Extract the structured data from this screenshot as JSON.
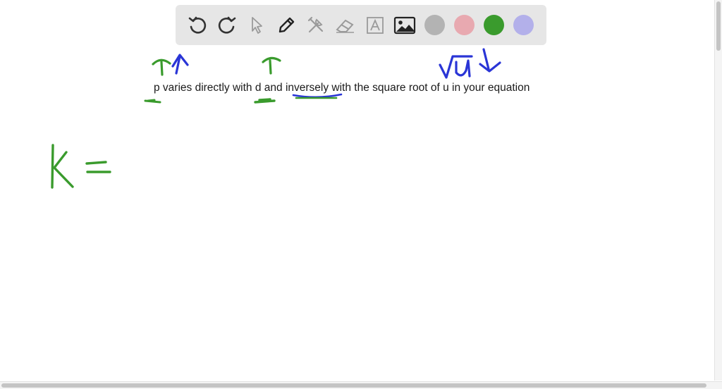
{
  "toolbar": {
    "tools": [
      {
        "name": "undo-icon",
        "enabled": true
      },
      {
        "name": "redo-icon",
        "enabled": true
      },
      {
        "name": "pointer-icon",
        "enabled": false
      },
      {
        "name": "pen-icon",
        "enabled": true
      },
      {
        "name": "tools-icon",
        "enabled": false
      },
      {
        "name": "eraser-icon",
        "enabled": false
      },
      {
        "name": "text-box-icon",
        "enabled": false
      },
      {
        "name": "image-icon",
        "enabled": true
      }
    ],
    "colors": [
      {
        "name": "gray",
        "hex": "#b3b3b3"
      },
      {
        "name": "pink",
        "hex": "#e8a9b0"
      },
      {
        "name": "green",
        "hex": "#3a9b2d"
      },
      {
        "name": "lavender",
        "hex": "#b3b0ea"
      }
    ]
  },
  "problem": {
    "text": "p varies directly with d and inversely with the square root of u in your equation"
  },
  "ink": {
    "green": "#3a9b2d",
    "blue": "#2a35d6"
  }
}
